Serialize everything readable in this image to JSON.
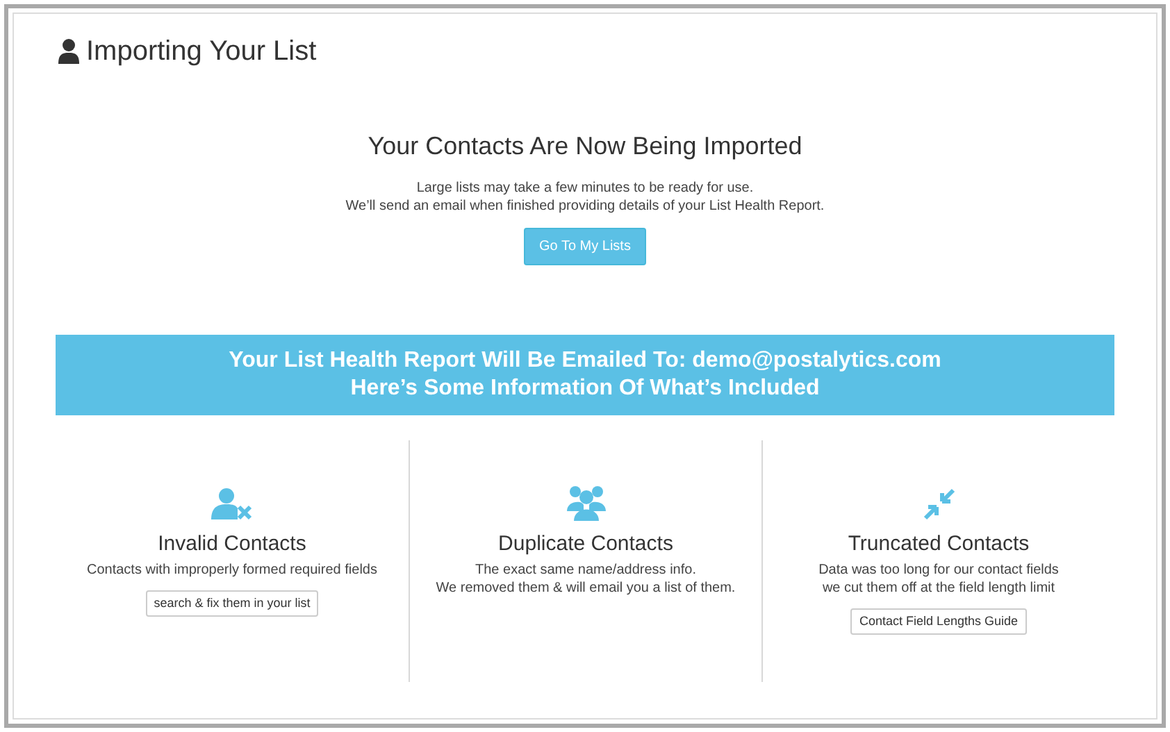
{
  "page": {
    "title": "Importing Your List"
  },
  "status": {
    "heading": "Your Contacts Are Now Being Imported",
    "lines": [
      "Large lists may take a few minutes to be ready for use.",
      "We’ll send an email when finished providing details of your List Health Report."
    ],
    "button": "Go To My Lists"
  },
  "banner": {
    "lines": [
      "Your List Health Report Will Be Emailed To: demo@postalytics.com",
      "Here’s Some Information Of What’s Included"
    ]
  },
  "cards": [
    {
      "kind": "invalid",
      "title": "Invalid Contacts",
      "lines": [
        "Contacts with improperly formed required fields"
      ],
      "button": "search & fix them in your list"
    },
    {
      "kind": "duplicate",
      "title": "Duplicate Contacts",
      "lines": [
        "The exact same name/address info.",
        "We removed them & will email you a list of them."
      ]
    },
    {
      "kind": "truncated",
      "title": "Truncated Contacts",
      "lines": [
        "Data was too long for our contact fields",
        "we cut them off at the field length limit"
      ],
      "button": "Contact Field Lengths Guide"
    }
  ]
}
